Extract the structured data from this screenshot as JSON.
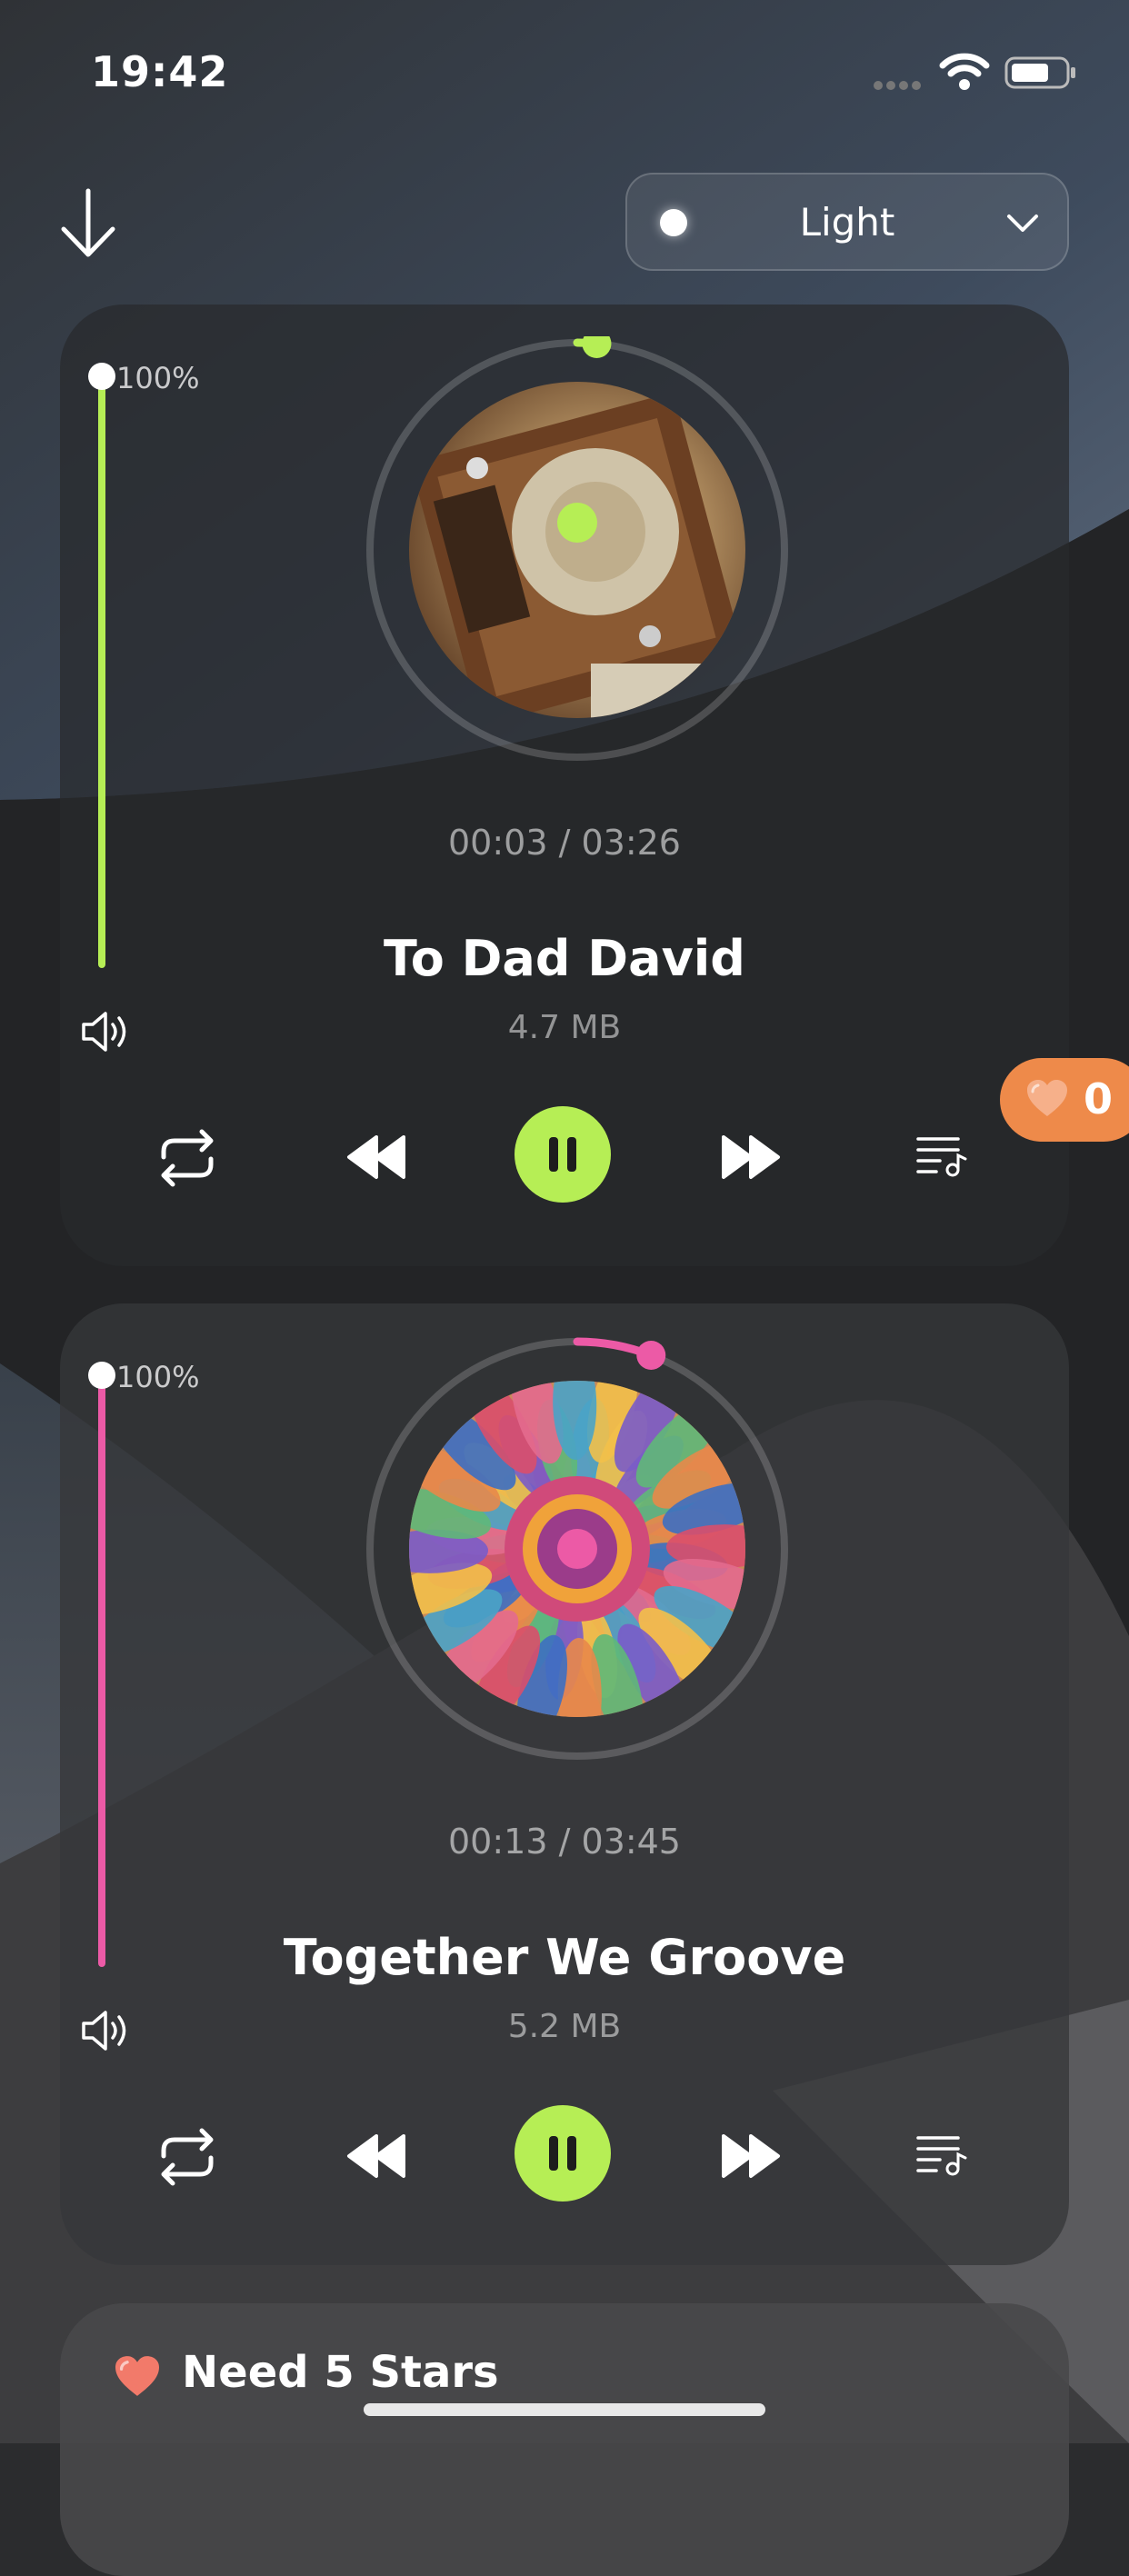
{
  "status_bar": {
    "time": "19:42"
  },
  "header": {
    "theme_select": {
      "selected": "Light"
    }
  },
  "players": [
    {
      "accent": "#b6ee55",
      "volume_label": "100%",
      "volume_fraction": 1.0,
      "time_label": "00:03 / 03:26",
      "title": "To Dad David",
      "size": "4.7 MB",
      "progress_fraction": 0.015
    },
    {
      "accent": "#ec5aa6",
      "volume_label": "100%",
      "volume_fraction": 1.0,
      "time_label": "00:13 / 03:45",
      "title": "Together We Groove",
      "size": "5.2 MB",
      "progress_fraction": 0.058
    }
  ],
  "likes_badge": {
    "count": "0",
    "color": "#ee8a4a"
  },
  "promo_card": {
    "text": "Need 5 Stars"
  },
  "icons": [
    "download-arrow-icon",
    "chevron-down-icon",
    "speaker-icon",
    "repeat-icon",
    "rewind-icon",
    "pause-icon",
    "fast-forward-icon",
    "playlist-icon",
    "heart-icon",
    "wifi-icon",
    "battery-icon"
  ]
}
